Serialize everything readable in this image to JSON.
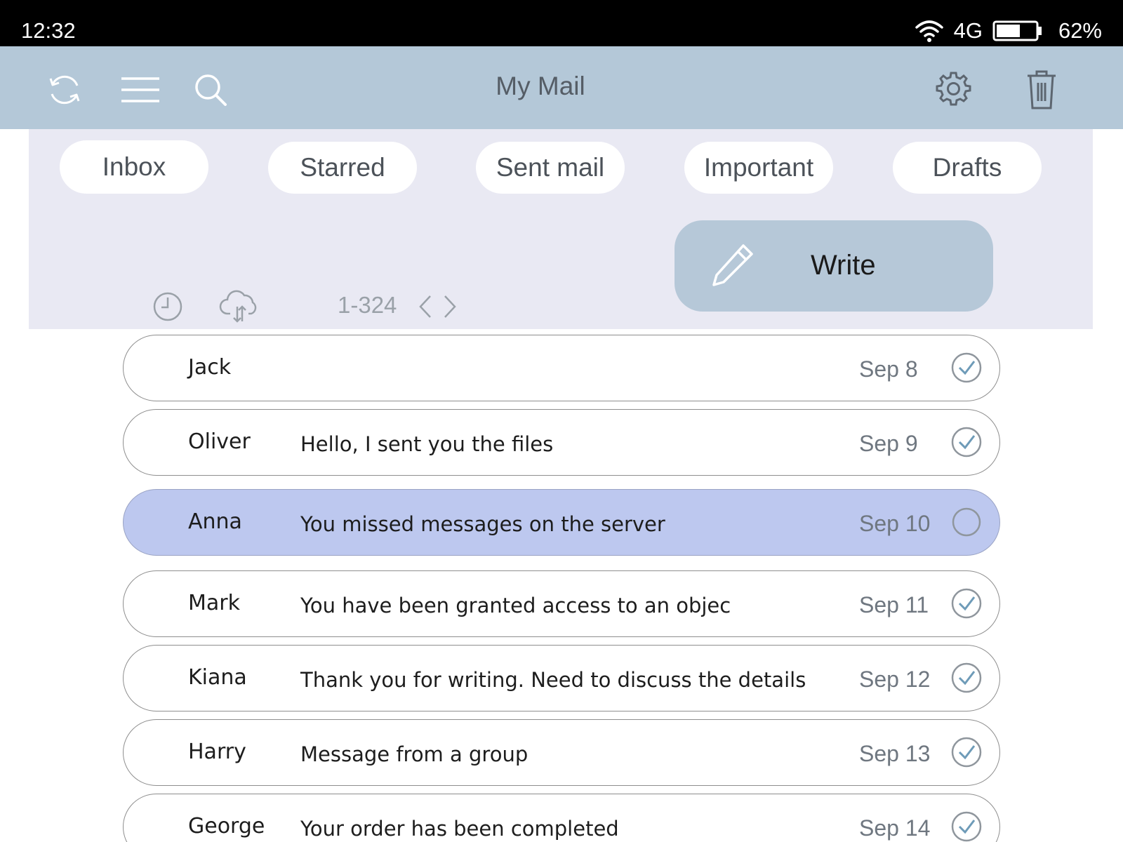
{
  "status_bar": {
    "time": "12:32",
    "network": "4G",
    "battery_percent": "62%",
    "battery_level": 0.62,
    "icons": [
      "wifi-icon",
      "battery-icon"
    ]
  },
  "header": {
    "title": "My Mail",
    "icons": [
      "refresh-icon",
      "menu-icon",
      "search-icon",
      "gear-icon",
      "trash-icon"
    ]
  },
  "folders": [
    {
      "label": "Inbox",
      "active": true
    },
    {
      "label": "Starred",
      "active": false
    },
    {
      "label": "Sent mail",
      "active": false
    },
    {
      "label": "Important",
      "active": false
    },
    {
      "label": "Drafts",
      "active": false
    }
  ],
  "toolbar": {
    "range": "1-324",
    "icons": [
      "clock-icon",
      "cloud-sync-icon",
      "chevron-left-icon",
      "chevron-right-icon"
    ],
    "write_label": "Write",
    "write_icon": "pencil-icon"
  },
  "colors": {
    "header_bg": "#b4c8d8",
    "panel_bg": "#e9e9f3",
    "selected_row": "#bdc8ef",
    "check": "#6e9bb8"
  },
  "messages": [
    {
      "sender": "Jack",
      "subject": "",
      "date": "Sep 8",
      "checked": true,
      "selected": false
    },
    {
      "sender": "Oliver",
      "subject": "Hello, I sent you the files",
      "date": "Sep 9",
      "checked": true,
      "selected": false
    },
    {
      "sender": "Anna",
      "subject": "You missed messages on the server",
      "date": "Sep 10",
      "checked": false,
      "selected": true
    },
    {
      "sender": "Mark",
      "subject": "You have been granted access to an objec",
      "date": "Sep 11",
      "checked": true,
      "selected": false
    },
    {
      "sender": "Kiana",
      "subject": "Thank you for writing. Need to discuss the details",
      "date": "Sep 12",
      "checked": true,
      "selected": false
    },
    {
      "sender": "Harry",
      "subject": "Message from a group",
      "date": "Sep 13",
      "checked": true,
      "selected": false
    },
    {
      "sender": "George",
      "subject": "Your order has been completed",
      "date": "Sep 14",
      "checked": true,
      "selected": false
    }
  ]
}
